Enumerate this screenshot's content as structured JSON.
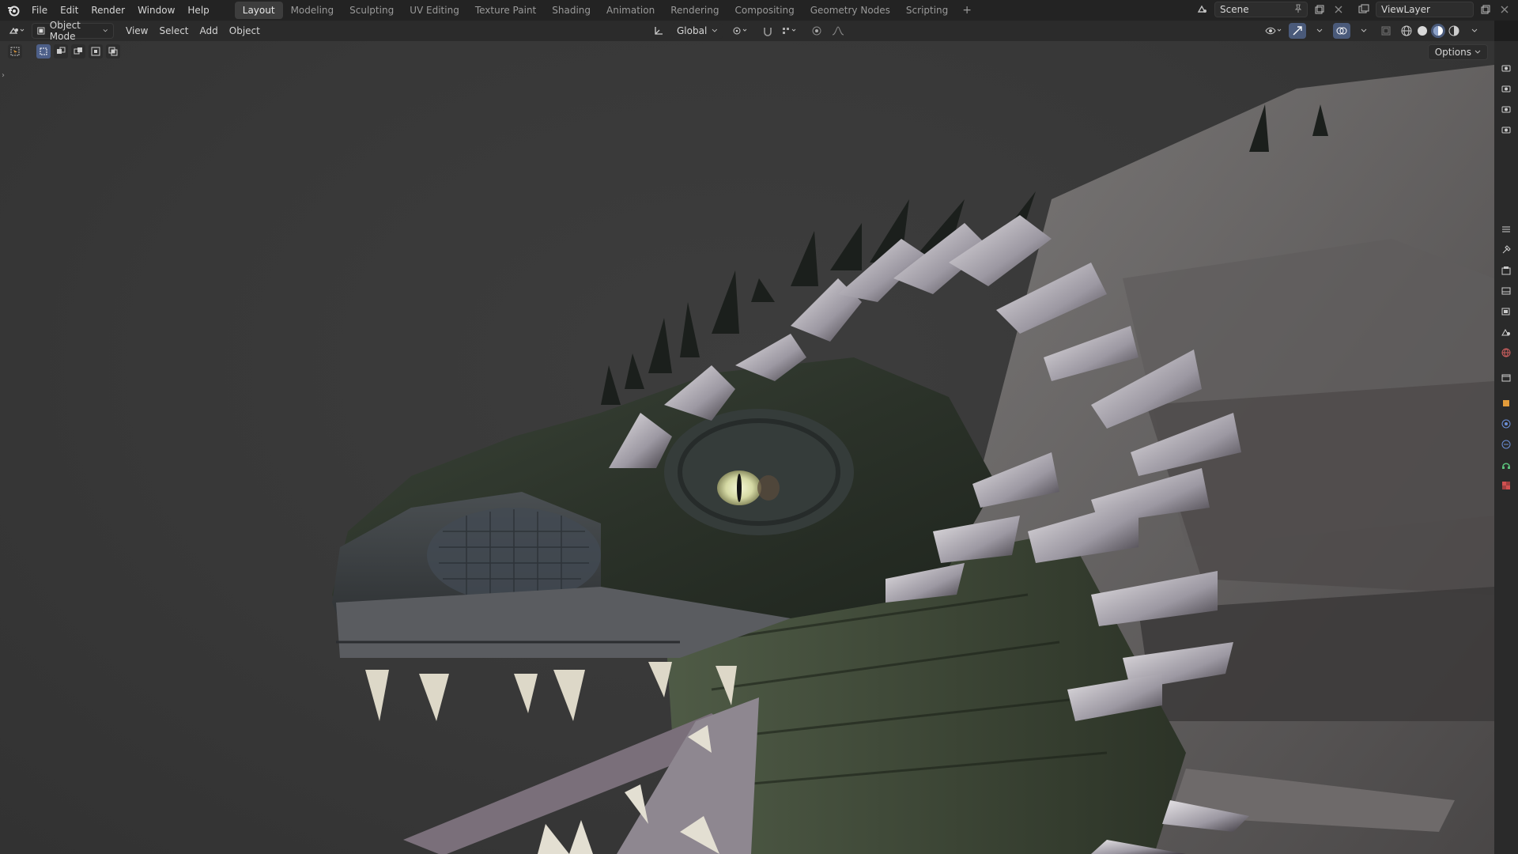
{
  "menu": {
    "items": [
      "File",
      "Edit",
      "Render",
      "Window",
      "Help"
    ]
  },
  "workspaces": {
    "tabs": [
      "Layout",
      "Modeling",
      "Sculpting",
      "UV Editing",
      "Texture Paint",
      "Shading",
      "Animation",
      "Rendering",
      "Compositing",
      "Geometry Nodes",
      "Scripting"
    ],
    "active": "Layout",
    "add_label": "+"
  },
  "scene": {
    "name": "Scene"
  },
  "view_layer": {
    "name": "ViewLayer"
  },
  "header": {
    "mode": "Object Mode",
    "menus": [
      "View",
      "Select",
      "Add",
      "Object"
    ],
    "transform_orientation": "Global"
  },
  "viewport": {
    "options_label": "Options"
  },
  "icons": {
    "logo": "blender-logo",
    "editor_type": "3d-viewport-icon",
    "props": [
      "tool-icon",
      "render-icon",
      "output-icon",
      "view-layer-icon",
      "scene-icon",
      "world-icon",
      "collection-icon",
      "object-icon",
      "modifier-icon",
      "physics-icon",
      "constraints-icon",
      "data-icon",
      "texture-icon"
    ]
  },
  "colors": {
    "accent": "#4a5a7a",
    "background": "#383838"
  }
}
